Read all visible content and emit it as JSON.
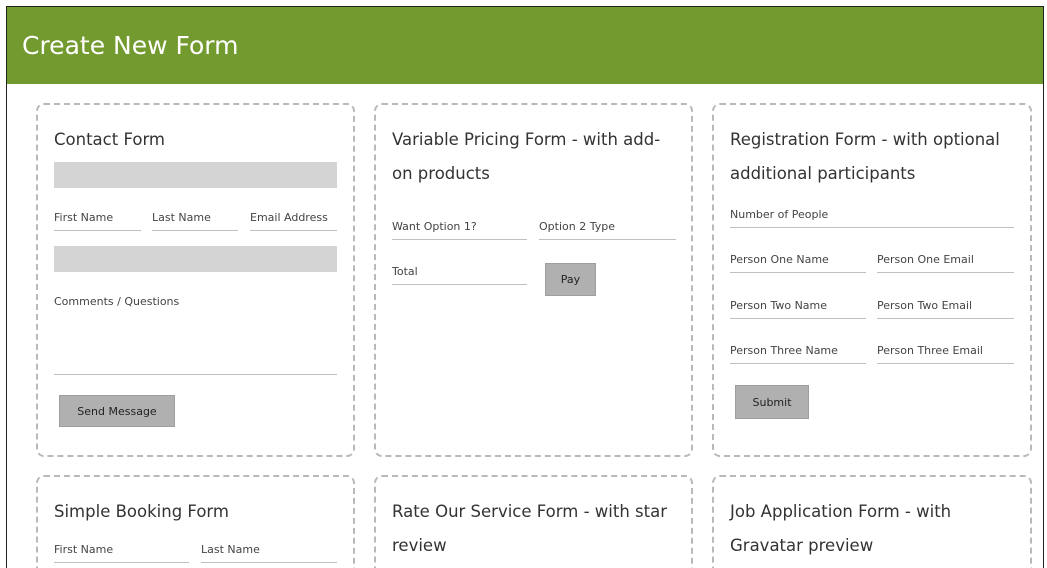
{
  "header": {
    "title": "Create New Form"
  },
  "cards": {
    "contact": {
      "title": "Contact Form",
      "first_name": "First Name",
      "last_name": "Last Name",
      "email": "Email Address",
      "comments": "Comments / Questions",
      "button": "Send Message"
    },
    "pricing": {
      "title": "Variable Pricing Form - with add-on products",
      "option1": "Want Option 1?",
      "option2": "Option 2 Type",
      "total": "Total",
      "button": "Pay"
    },
    "registration": {
      "title": "Registration Form - with optional additional participants",
      "num_people": "Number of People",
      "p1_name": "Person One Name",
      "p1_email": "Person One Email",
      "p2_name": "Person Two Name",
      "p2_email": "Person Two Email",
      "p3_name": "Person Three Name",
      "p3_email": "Person Three Email",
      "button": "Submit"
    },
    "booking": {
      "title": "Simple Booking Form",
      "first_name": "First Name",
      "last_name": "Last Name"
    },
    "rating": {
      "title": "Rate Our Service Form - with star review"
    },
    "job": {
      "title": "Job Application Form - with Gravatar preview"
    }
  }
}
